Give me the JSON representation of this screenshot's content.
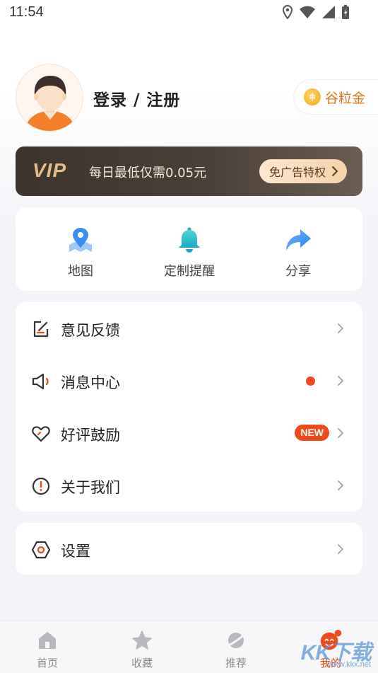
{
  "status": {
    "time": "11:54"
  },
  "profile": {
    "login_label": "登录 / 注册",
    "gold_label": "谷粒金"
  },
  "vip": {
    "logo": "VIP",
    "text": "每日最低仅需0.05元",
    "button": "免广告特权"
  },
  "quick": [
    {
      "label": "地图",
      "icon": "map-pin-icon"
    },
    {
      "label": "定制提醒",
      "icon": "bell-icon"
    },
    {
      "label": "分享",
      "icon": "share-arrow-icon"
    }
  ],
  "menu": [
    {
      "label": "意见反馈",
      "icon": "feedback-edit-icon"
    },
    {
      "label": "消息中心",
      "icon": "speaker-icon"
    },
    {
      "label": "好评鼓励",
      "icon": "heart-icon",
      "badge": "NEW"
    },
    {
      "label": "关于我们",
      "icon": "info-circle-icon"
    }
  ],
  "settings": {
    "label": "设置",
    "icon": "gear-hexagon-icon"
  },
  "tabs": [
    {
      "label": "首页",
      "icon": "home-icon"
    },
    {
      "label": "收藏",
      "icon": "star-icon"
    },
    {
      "label": "推荐",
      "icon": "planet-icon"
    },
    {
      "label": "我的",
      "icon": "mascot-icon",
      "active": true
    }
  ],
  "watermark": {
    "text": "KK下载",
    "url": "www.kkx.net"
  },
  "colors": {
    "accent": "#ee4a1c",
    "gold": "#e0781c",
    "vip_bg": "#3d342b",
    "icon_blue": "#3a8ef0"
  }
}
